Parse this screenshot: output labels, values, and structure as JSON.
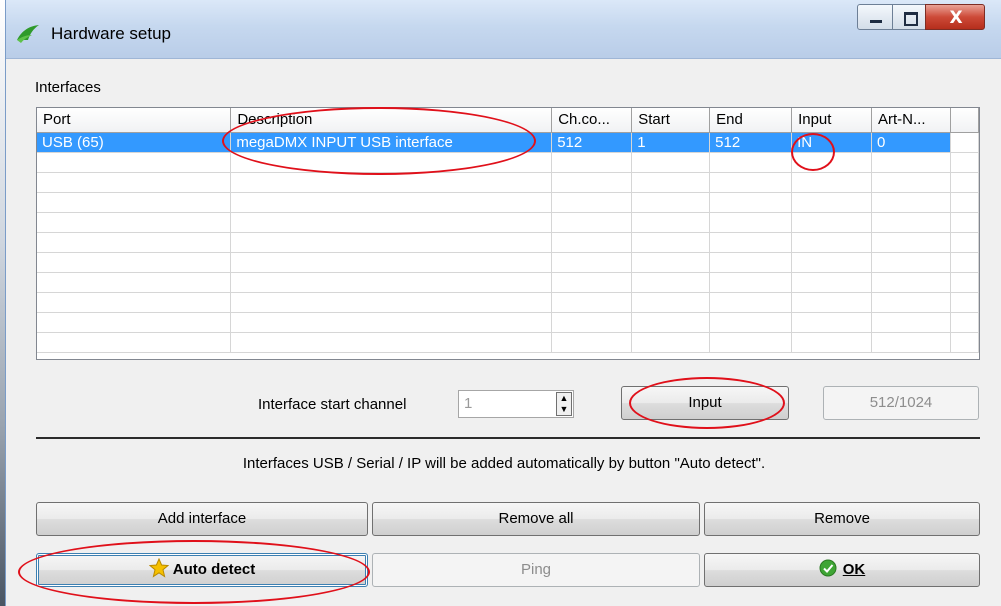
{
  "window": {
    "title": "Hardware setup",
    "close_glyph": "X"
  },
  "interfaces": {
    "group_label": "Interfaces",
    "columns": [
      "Port",
      "Description",
      "Ch.co...",
      "Start",
      "End",
      "Input",
      "Art-N..."
    ],
    "rows": [
      {
        "port": "USB (65)",
        "description": "megaDMX INPUT USB interface",
        "channels": "512",
        "start": "1",
        "end": "512",
        "input": "IN",
        "art_net": "0"
      }
    ]
  },
  "start_channel": {
    "label": "Interface start channel",
    "value": "1"
  },
  "buttons": {
    "input": "Input",
    "range": "512/1024",
    "add_interface": "Add interface",
    "remove_all": "Remove all",
    "remove": "Remove",
    "auto_detect": "Auto detect",
    "ping": "Ping",
    "ok": "OK"
  },
  "info_text": "Interfaces USB / Serial / IP will be added automatically by button \"Auto detect\".",
  "icons": {
    "app": "hardware-logo-icon",
    "auto_detect": "star-icon",
    "ok": "check-circle-icon",
    "spinner": "spin-arrows-icon"
  },
  "colors": {
    "selection": "#3399ff",
    "annotation": "#e0101a",
    "ok_icon": "#3fa535",
    "star_icon": "#f5c000"
  }
}
